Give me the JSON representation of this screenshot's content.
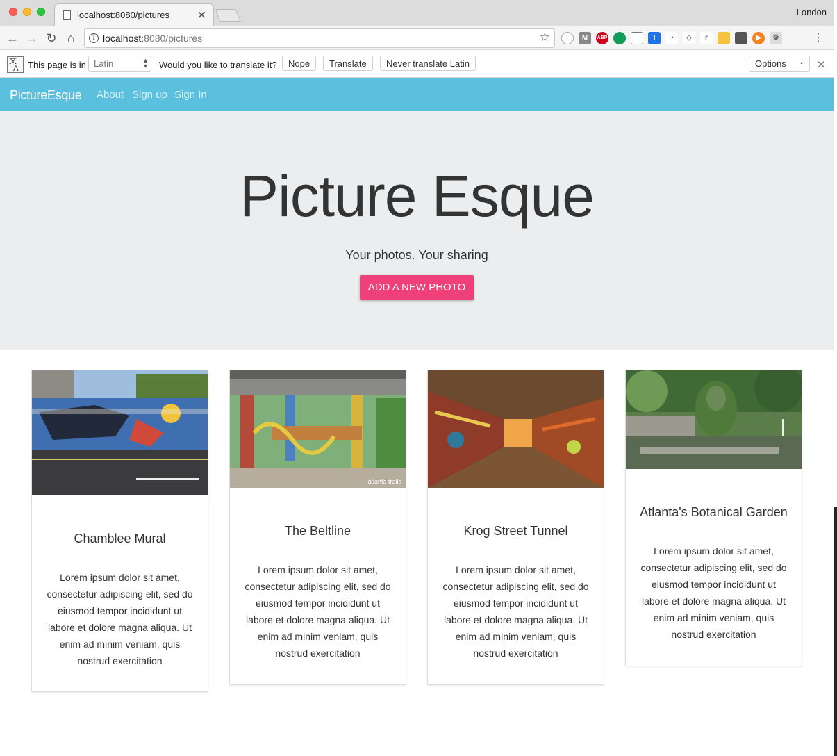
{
  "browser": {
    "tab_title": "localhost:8080/pictures",
    "profile": "London",
    "url_host": "localhost",
    "url_rest": ":8080/pictures"
  },
  "translate_bar": {
    "page_is_in": "This page is in",
    "language": "Latin",
    "question": "Would you like to translate it?",
    "nope": "Nope",
    "translate": "Translate",
    "never": "Never translate Latin",
    "options": "Options"
  },
  "navbar": {
    "brand": "PictureEsque",
    "links": [
      "About",
      "Sign up",
      "Sign In"
    ]
  },
  "hero": {
    "title": "Picture Esque",
    "subtitle": "Your photos. Your sharing",
    "cta": "ADD A NEW PHOTO"
  },
  "cards": [
    {
      "title": "Chamblee Mural",
      "image_caption": "",
      "text": "Lorem ipsum dolor sit amet, consectetur adipiscing elit, sed do eiusmod tempor incididunt ut labore et dolore magna aliqua. Ut enim ad minim veniam, quis nostrud exercitation"
    },
    {
      "title": "The Beltline",
      "image_caption": "atlanta trails",
      "text": "Lorem ipsum dolor sit amet, consectetur adipiscing elit, sed do eiusmod tempor incididunt ut labore et dolore magna aliqua. Ut enim ad minim veniam, quis nostrud exercitation"
    },
    {
      "title": "Krog Street Tunnel",
      "image_caption": "",
      "text": "Lorem ipsum dolor sit amet, consectetur adipiscing elit, sed do eiusmod tempor incididunt ut labore et dolore magna aliqua. Ut enim ad minim veniam, quis nostrud exercitation"
    },
    {
      "title": "Atlanta's Botanical Garden",
      "image_caption": "",
      "text": "Lorem ipsum dolor sit amet, consectetur adipiscing elit, sed do eiusmod tempor incididunt ut labore et dolore magna aliqua. Ut enim ad minim veniam, quis nostrud exercitation"
    }
  ],
  "colors": {
    "navbar": "#5bc0de",
    "cta": "#f0407a",
    "hero_bg": "#ecedef"
  }
}
